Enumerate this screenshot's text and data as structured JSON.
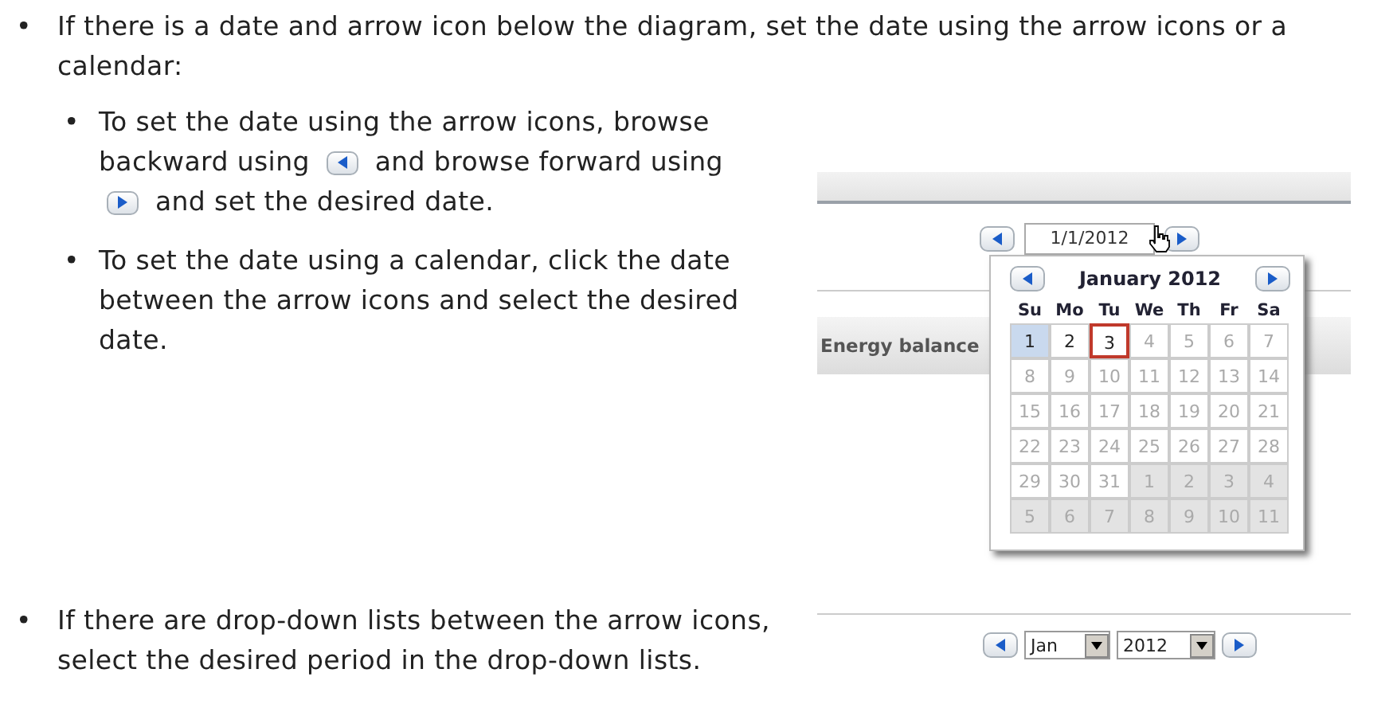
{
  "intro": {
    "bullet": "•",
    "text": "If there is a date and arrow icon below the diagram, set the date using the arrow icons or a calendar:"
  },
  "steps": [
    {
      "bullet": "•",
      "parts": [
        {
          "kind": "text",
          "text": "To set the date using the arrow icons, browse"
        },
        {
          "kind": "text",
          "text": "backward using"
        },
        {
          "kind": "back"
        },
        {
          "kind": "text",
          "text": "and browse forward using"
        },
        {
          "kind": "forward"
        },
        {
          "kind": "text",
          "text": "and set the desired date."
        }
      ]
    },
    {
      "bullet": "•",
      "parts": [
        {
          "kind": "text",
          "text": "To set the date using a calendar, click the date between the arrow icons and select the desired date."
        }
      ]
    }
  ],
  "screenshot": {
    "date": "1/1/2012",
    "tab_label": "Energy balance",
    "calendar": {
      "title": "January 2012",
      "weekdays": [
        "Su",
        "Mo",
        "Tu",
        "We",
        "Th",
        "Fr",
        "Sa"
      ],
      "weeks": [
        [
          {
            "text": "1",
            "muted": false,
            "outside": false,
            "highlighted": true,
            "selected": false
          },
          {
            "text": "2",
            "muted": false,
            "outside": false,
            "highlighted": false,
            "selected": false
          },
          {
            "text": "3",
            "muted": false,
            "outside": false,
            "highlighted": false,
            "selected": true
          },
          {
            "text": "4",
            "muted": true,
            "outside": false,
            "highlighted": false,
            "selected": false
          },
          {
            "text": "5",
            "muted": true,
            "outside": false,
            "highlighted": false,
            "selected": false
          },
          {
            "text": "6",
            "muted": true,
            "outside": false,
            "highlighted": false,
            "selected": false
          },
          {
            "text": "7",
            "muted": true,
            "outside": false,
            "highlighted": false,
            "selected": false
          }
        ],
        [
          {
            "text": "8",
            "muted": true,
            "outside": false,
            "highlighted": false,
            "selected": false
          },
          {
            "text": "9",
            "muted": true,
            "outside": false,
            "highlighted": false,
            "selected": false
          },
          {
            "text": "10",
            "muted": true,
            "outside": false,
            "highlighted": false,
            "selected": false
          },
          {
            "text": "11",
            "muted": true,
            "outside": false,
            "highlighted": false,
            "selected": false
          },
          {
            "text": "12",
            "muted": true,
            "outside": false,
            "highlighted": false,
            "selected": false
          },
          {
            "text": "13",
            "muted": true,
            "outside": false,
            "highlighted": false,
            "selected": false
          },
          {
            "text": "14",
            "muted": true,
            "outside": false,
            "highlighted": false,
            "selected": false
          }
        ],
        [
          {
            "text": "15",
            "muted": true,
            "outside": false,
            "highlighted": false,
            "selected": false
          },
          {
            "text": "16",
            "muted": true,
            "outside": false,
            "highlighted": false,
            "selected": false
          },
          {
            "text": "17",
            "muted": true,
            "outside": false,
            "highlighted": false,
            "selected": false
          },
          {
            "text": "18",
            "muted": true,
            "outside": false,
            "highlighted": false,
            "selected": false
          },
          {
            "text": "19",
            "muted": true,
            "outside": false,
            "highlighted": false,
            "selected": false
          },
          {
            "text": "20",
            "muted": true,
            "outside": false,
            "highlighted": false,
            "selected": false
          },
          {
            "text": "21",
            "muted": true,
            "outside": false,
            "highlighted": false,
            "selected": false
          }
        ],
        [
          {
            "text": "22",
            "muted": true,
            "outside": false,
            "highlighted": false,
            "selected": false
          },
          {
            "text": "23",
            "muted": true,
            "outside": false,
            "highlighted": false,
            "selected": false
          },
          {
            "text": "24",
            "muted": true,
            "outside": false,
            "highlighted": false,
            "selected": false
          },
          {
            "text": "25",
            "muted": true,
            "outside": false,
            "highlighted": false,
            "selected": false
          },
          {
            "text": "26",
            "muted": true,
            "outside": false,
            "highlighted": false,
            "selected": false
          },
          {
            "text": "27",
            "muted": true,
            "outside": false,
            "highlighted": false,
            "selected": false
          },
          {
            "text": "28",
            "muted": true,
            "outside": false,
            "highlighted": false,
            "selected": false
          }
        ],
        [
          {
            "text": "29",
            "muted": true,
            "outside": false,
            "highlighted": false,
            "selected": false
          },
          {
            "text": "30",
            "muted": true,
            "outside": false,
            "highlighted": false,
            "selected": false
          },
          {
            "text": "31",
            "muted": true,
            "outside": false,
            "highlighted": false,
            "selected": false
          },
          {
            "text": "1",
            "muted": true,
            "outside": true,
            "highlighted": false,
            "selected": false
          },
          {
            "text": "2",
            "muted": true,
            "outside": true,
            "highlighted": false,
            "selected": false
          },
          {
            "text": "3",
            "muted": true,
            "outside": true,
            "highlighted": false,
            "selected": false
          },
          {
            "text": "4",
            "muted": true,
            "outside": true,
            "highlighted": false,
            "selected": false
          }
        ],
        [
          {
            "text": "5",
            "muted": true,
            "outside": true,
            "highlighted": false,
            "selected": false
          },
          {
            "text": "6",
            "muted": true,
            "outside": true,
            "highlighted": false,
            "selected": false
          },
          {
            "text": "7",
            "muted": true,
            "outside": true,
            "highlighted": false,
            "selected": false
          },
          {
            "text": "8",
            "muted": true,
            "outside": true,
            "highlighted": false,
            "selected": false
          },
          {
            "text": "9",
            "muted": true,
            "outside": true,
            "highlighted": false,
            "selected": false
          },
          {
            "text": "10",
            "muted": true,
            "outside": true,
            "highlighted": false,
            "selected": false
          },
          {
            "text": "11",
            "muted": true,
            "outside": true,
            "highlighted": false,
            "selected": false
          }
        ]
      ]
    }
  },
  "dropdowns": {
    "bullet": "•",
    "text": "If there are drop-down lists between the arrow icons, select the desired period in the drop-down lists.",
    "month": "Jan",
    "year": "2012"
  }
}
